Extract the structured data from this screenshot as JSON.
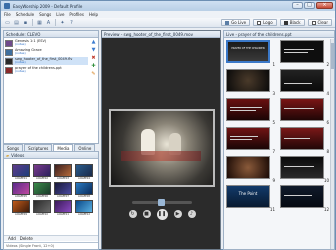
{
  "app": {
    "title": "EasyWorship 2009 - Default Profile"
  },
  "menu": [
    "File",
    "Schedule",
    "Songs",
    "Live",
    "Profiles",
    "Help"
  ],
  "toolbar": {
    "go_live": "Go Live",
    "logo": "Logo",
    "black": "Black",
    "clear": "Clear"
  },
  "schedule": {
    "header": "Schedule: CLEVO",
    "items": [
      {
        "title": "Genesis 1:1 (ESV)",
        "sub": "(notes)"
      },
      {
        "title": "Amazing Grace",
        "sub": "(notes)"
      },
      {
        "title": "swg_hooter_of_the_first_0049.flv",
        "sub": "(notes)"
      },
      {
        "title": "prayer of the childrens.ppt",
        "sub": "(notes)"
      }
    ]
  },
  "tabs": [
    "Songs",
    "Scriptures",
    "Media",
    "Online"
  ],
  "library": {
    "header": "Videos",
    "items": [
      "AOGEE01",
      "AOGEE02",
      "AOGEE03",
      "AOGEE04",
      "AOGEE05",
      "AOGEE06",
      "AOGEE07",
      "AOGEE08",
      "AOGEE09",
      "AOGEE10",
      "AOGEE11",
      "AOGEE12"
    ],
    "add_label": "Add",
    "delete_label": "Delete",
    "search_text": "Videos (Single Front, 12+0)"
  },
  "preview": {
    "header": "Preview - swg_hooter_of_the_first_0049.mov"
  },
  "live": {
    "header": "Live - prayer of the childrens.ppt",
    "slides": [
      {
        "num": "1",
        "title": "PRAYER OF THE CHILDREN"
      },
      {
        "num": "2",
        "title": ""
      },
      {
        "num": "3",
        "title": ""
      },
      {
        "num": "4",
        "title": ""
      },
      {
        "num": "5",
        "title": ""
      },
      {
        "num": "6",
        "title": ""
      },
      {
        "num": "7",
        "title": ""
      },
      {
        "num": "8",
        "title": ""
      },
      {
        "num": "9",
        "title": ""
      },
      {
        "num": "10",
        "title": ""
      },
      {
        "num": "11",
        "title": "The Point"
      },
      {
        "num": "12",
        "title": ""
      }
    ]
  }
}
